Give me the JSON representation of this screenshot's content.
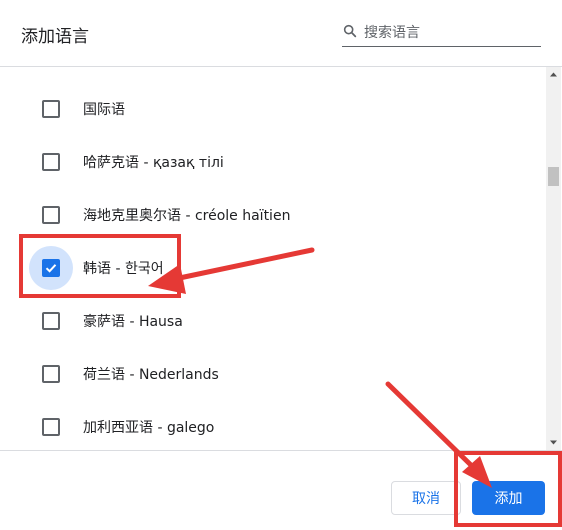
{
  "dialog": {
    "title": "添加语言"
  },
  "search": {
    "placeholder": "搜索语言",
    "value": "",
    "icon": "search-icon"
  },
  "languages": [
    {
      "label": "国际语",
      "checked": false
    },
    {
      "label": "哈萨克语 - қазақ тілі",
      "checked": false
    },
    {
      "label": "海地克里奥尔语 - créole haïtien",
      "checked": false
    },
    {
      "label": "韩语 - 한국어",
      "checked": true
    },
    {
      "label": "豪萨语 - Hausa",
      "checked": false
    },
    {
      "label": "荷兰语 - Nederlands",
      "checked": false
    },
    {
      "label": "加利西亚语 - galego",
      "checked": false
    }
  ],
  "footer": {
    "cancel_label": "取消",
    "add_label": "添加"
  },
  "colors": {
    "accent": "#1a73e8",
    "annotation": "#e53935",
    "checked_ripple": "#d2e3fc"
  }
}
